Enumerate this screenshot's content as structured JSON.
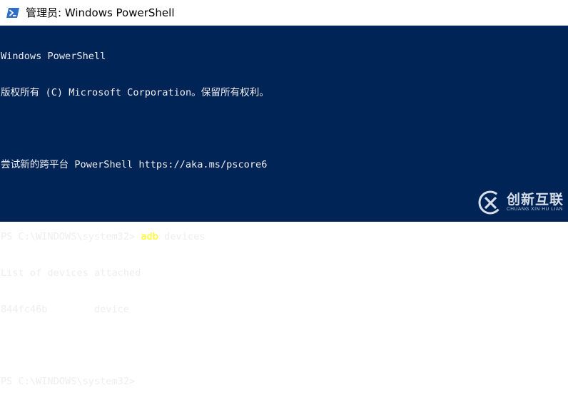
{
  "window": {
    "title": "管理员: Windows PowerShell",
    "icon": "powershell-icon"
  },
  "console": {
    "background": "#012456",
    "foreground": "#eeedf0",
    "command_color": "#ffff00",
    "lines": {
      "l1": "Windows PowerShell",
      "l2": "版权所有 (C) Microsoft Corporation。保留所有权利。",
      "l3": "",
      "l4": "尝试新的跨平台 PowerShell https://aka.ms/pscore6",
      "l5": "",
      "l6_prompt": "PS C:\\WINDOWS\\system32> ",
      "l6_cmd": "adb",
      "l6_arg": " devices",
      "l7": "List of devices attached",
      "l8": "844fc46b        device",
      "l9": "",
      "l10_prompt": "PS C:\\WINDOWS\\system32> "
    }
  },
  "watermark": {
    "title": "创新互联",
    "subtitle": "CHUANG XIN HU LIAN",
    "icon": "chuangxin-logo-icon"
  }
}
